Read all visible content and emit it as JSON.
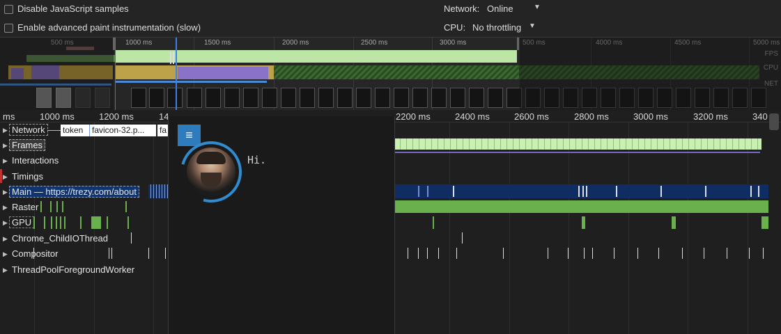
{
  "settings": {
    "disable_js_samples": "Disable JavaScript samples",
    "advanced_paint": "Enable advanced paint instrumentation (slow)",
    "network_label": "Network:",
    "network_value": "Online",
    "cpu_label": "CPU:",
    "cpu_value": "No throttling",
    "caret_icon": "▼"
  },
  "overview": {
    "ticks": [
      "500 ms",
      "1000 ms",
      "1500 ms",
      "2000 ms",
      "2500 ms",
      "3000 ms",
      "500 ms",
      "4000 ms",
      "4500 ms",
      "5000 ms"
    ],
    "fps_label": "FPS",
    "cpu_label": "CPU",
    "net_label": "NET"
  },
  "ruler": {
    "ticks": [
      "ms",
      "1000 ms",
      "1200 ms",
      "14",
      "2200 ms",
      "2400 ms",
      "2600 ms",
      "2800 ms",
      "3000 ms",
      "3200 ms",
      "340"
    ]
  },
  "tracks": {
    "network": "Network",
    "frames": "Frames",
    "interactions": "Interactions",
    "timings": "Timings",
    "main": "Main — https://trezy.com/about",
    "raster": "Raster",
    "gpu": "GPU",
    "childio": "Chrome_ChildIOThread",
    "compositor": "Compositor",
    "threadpool": "ThreadPoolForegroundWorker",
    "expand_icon": "▶"
  },
  "network_requests": [
    "token",
    "favicon-32.p...",
    "fa"
  ],
  "overlay": {
    "menu_icon": "≡",
    "greeting": "Hi."
  },
  "colors": {
    "fps": "#bde6a6",
    "cpu_scripting": "#c9a53a",
    "cpu_rendering": "#8a72c8",
    "selection": "#3f7fe8",
    "main_thread": "#0f2d63",
    "raster": "#6ab04c"
  }
}
